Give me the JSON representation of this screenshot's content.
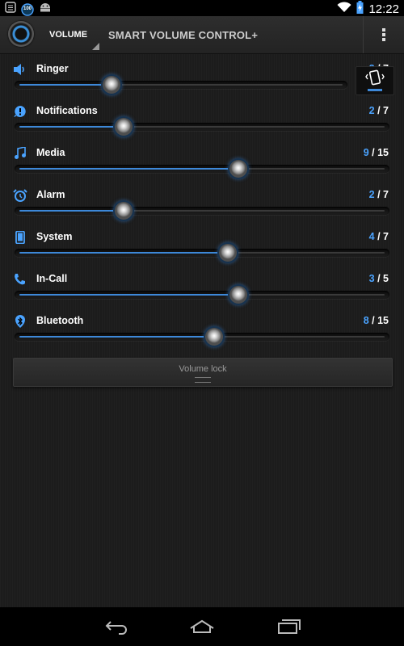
{
  "status_bar": {
    "time": "12:22",
    "icons": [
      "notification-icon",
      "battery-saver-icon",
      "android-icon",
      "wifi-icon",
      "battery-charging-icon"
    ],
    "indicator_text": "100"
  },
  "action_bar": {
    "spinner_label": "VOLUME",
    "title": "SMART VOLUME CONTROL+"
  },
  "accent_color": "#3d88d8",
  "streams": [
    {
      "label": "Ringer",
      "current": "2",
      "max": "7",
      "icon": "speaker-icon",
      "level": 0.2857
    },
    {
      "label": "Notifications",
      "current": "2",
      "max": "7",
      "icon": "alert-icon",
      "level": 0.2857
    },
    {
      "label": "Media",
      "current": "9",
      "max": "15",
      "icon": "music-note-icon",
      "level": 0.6
    },
    {
      "label": "Alarm",
      "current": "2",
      "max": "7",
      "icon": "alarm-clock-icon",
      "level": 0.2857
    },
    {
      "label": "System",
      "current": "4",
      "max": "7",
      "icon": "phone-device-icon",
      "level": 0.5714
    },
    {
      "label": "In-Call",
      "current": "3",
      "max": "5",
      "icon": "phone-call-icon",
      "level": 0.6
    },
    {
      "label": "Bluetooth",
      "current": "8",
      "max": "15",
      "icon": "bluetooth-icon",
      "level": 0.5333
    }
  ],
  "ringer_mode": {
    "icon": "vibrate-icon"
  },
  "volume_lock": {
    "label": "Volume lock"
  },
  "nav": {
    "icons": [
      "back-icon",
      "home-icon",
      "recents-icon"
    ]
  }
}
